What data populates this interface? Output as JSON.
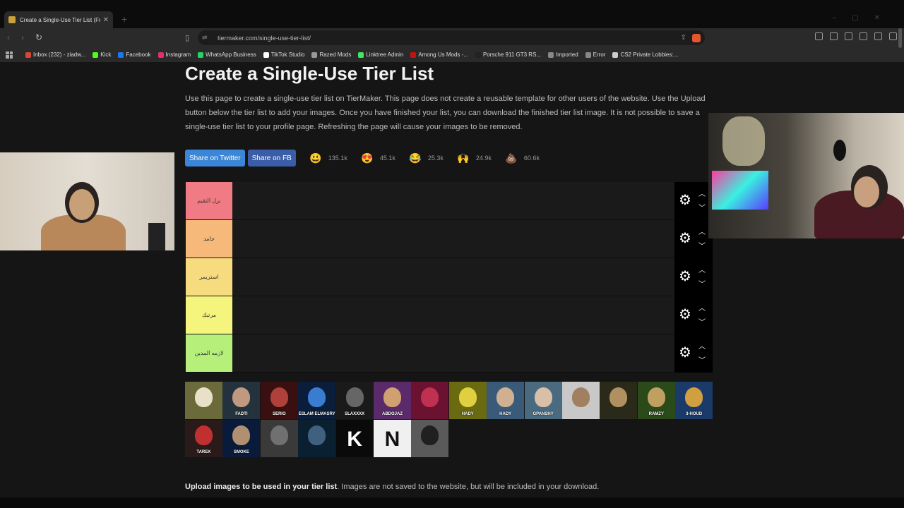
{
  "browser": {
    "tab_title": "Create a Single-Use Tier List (Fr",
    "url": "tiermaker.com/single-use-tier-list/",
    "bookmarks": [
      {
        "label": "Inbox (232) - ziadw...",
        "color": "#d44638"
      },
      {
        "label": "Kick",
        "color": "#53fc18"
      },
      {
        "label": "Facebook",
        "color": "#1877f2"
      },
      {
        "label": "Instagram",
        "color": "#e1306c"
      },
      {
        "label": "WhatsApp Business",
        "color": "#25d366"
      },
      {
        "label": "TikTok Studio",
        "color": "#ffffff"
      },
      {
        "label": "Razed Mods",
        "color": "#999999"
      },
      {
        "label": "Linktree Admin",
        "color": "#43e660"
      },
      {
        "label": "Among Us Mods -...",
        "color": "#c51111"
      },
      {
        "label": "Porsche 911 GT3 RS...",
        "color": "#222222"
      },
      {
        "label": "Imported",
        "color": "#888888"
      },
      {
        "label": "Error",
        "color": "#888888"
      },
      {
        "label": "CS2 Private Lobbies:...",
        "color": "#cccccc"
      }
    ]
  },
  "page": {
    "title": "Create a Single-Use Tier List",
    "description": "Use this page to create a single-use tier list on TierMaker. This page does not create a reusable template for other users of the website. Use the Upload button below the tier list to add your images. Once you have finished your list, you can download the finished tier list image. It is not possible to save a single-use tier list to your profile page. Refreshing the page will cause your images to be removed.",
    "share_twitter": "Share on Twitter",
    "share_fb": "Share on FB",
    "reactions": [
      {
        "icon": "grin-emoji-icon",
        "glyph": "😃",
        "count": "135.1k"
      },
      {
        "icon": "heart-eyes-emoji-icon",
        "glyph": "😍",
        "count": "45.1k"
      },
      {
        "icon": "laughing-emoji-icon",
        "glyph": "😂",
        "count": "25.3k"
      },
      {
        "icon": "raised-hands-emoji-icon",
        "glyph": "🙌",
        "count": "24.9k"
      },
      {
        "icon": "poop-emoji-icon",
        "glyph": "💩",
        "count": "60.6k"
      }
    ],
    "upload_bold": "Upload images to be used in your tier list",
    "upload_text": ". Images are not saved to the website, but will be included in your download."
  },
  "tiers": [
    {
      "label": "نزل التقيم",
      "color": "#f07b84"
    },
    {
      "label": "جامد",
      "color": "#f6b97a"
    },
    {
      "label": "استريمر",
      "color": "#f7dc7f"
    },
    {
      "label": "مرتبك",
      "color": "#f5f57d"
    },
    {
      "label": "لازمه المدين",
      "color": "#b6f07b"
    }
  ],
  "thumbnails": [
    {
      "caption": "",
      "bg": "#6a6a3a",
      "face": "#e8e0c8"
    },
    {
      "caption": "FADTI",
      "bg": "#23323c",
      "face": "#c09a80"
    },
    {
      "caption": "SERIO",
      "bg": "#3a0f0f",
      "face": "#b0403a"
    },
    {
      "caption": "ESLAM ELMASRY",
      "bg": "#0a1e3c",
      "face": "#3a7cd0"
    },
    {
      "caption": "SLAXXXX",
      "bg": "#1a1a1a",
      "face": "#666666"
    },
    {
      "caption": "ABDOJAZ",
      "bg": "#5a2a6a",
      "face": "#d0a070"
    },
    {
      "caption": "",
      "bg": "#6a1230",
      "face": "#c03050"
    },
    {
      "caption": "HADY",
      "bg": "#6a6a10",
      "face": "#e0d040"
    },
    {
      "caption": "HADY",
      "bg": "#3a5a7a",
      "face": "#d0b090"
    },
    {
      "caption": "GPANSHY",
      "bg": "#4a6a80",
      "face": "#d8c0a8"
    },
    {
      "caption": "",
      "bg": "#c8c8c8",
      "face": "#a08060"
    },
    {
      "caption": "",
      "bg": "#2a2a1a",
      "face": "#b09060"
    },
    {
      "caption": "RAMZY",
      "bg": "#2a4a1a",
      "face": "#c0a060"
    },
    {
      "caption": "3-HOUD",
      "bg": "#1a3a6a",
      "face": "#d0a040"
    },
    {
      "caption": "TAREK",
      "bg": "#2a1a1a",
      "face": "#c03030"
    },
    {
      "caption": "SMOKE",
      "bg": "#0a1a3a",
      "face": "#b09070"
    },
    {
      "caption": "",
      "bg": "#3a3a3a",
      "face": "#707070"
    },
    {
      "caption": "",
      "bg": "#0a2030",
      "face": "#406080"
    },
    {
      "caption": "K",
      "bg": "#0a0a0a",
      "face": "#0a0a0a"
    },
    {
      "caption": "N",
      "bg": "#f0f0f0",
      "face": "#f0f0f0"
    },
    {
      "caption": "",
      "bg": "#5a5a5a",
      "face": "#202020"
    }
  ]
}
